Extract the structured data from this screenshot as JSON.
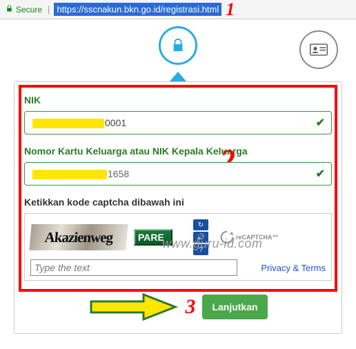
{
  "address_bar": {
    "secure_label": "Secure",
    "url": "https://sscnakun.bkn.go.id/registrasi.html"
  },
  "annotations": {
    "one": "1",
    "two": "2",
    "three": "3"
  },
  "watermark": "www.guru-id.com",
  "form": {
    "nik": {
      "label": "NIK",
      "value_visible": "0001"
    },
    "kk": {
      "label": "Nomor Kartu Keluarga atau NIK Kepala Keluarga",
      "value_visible": "1658"
    },
    "captcha": {
      "label": "Ketikkan kode captcha dibawah ini",
      "challenge_word1": "Akazienweg",
      "challenge_word2": "PARE",
      "input_placeholder": "Type the text",
      "recaptcha_brand": "reCAPTCHA™",
      "privacy_terms": "Privacy & Terms",
      "icons": {
        "refresh": "refresh-icon",
        "audio": "audio-icon",
        "help": "help-icon"
      }
    }
  },
  "actions": {
    "submit": "Lanjutkan"
  }
}
